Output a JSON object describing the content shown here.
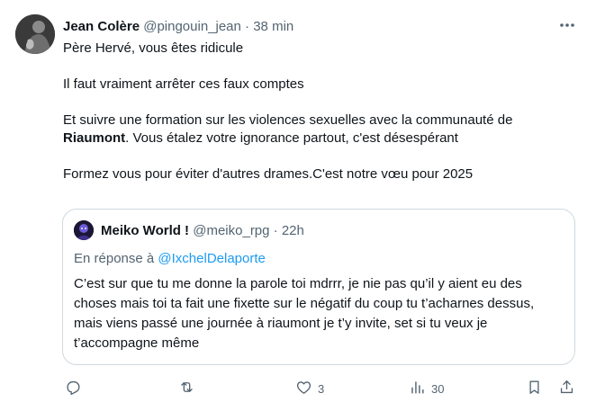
{
  "tweet": {
    "author_name": "Jean Colère",
    "author_handle": "@pingouin_jean",
    "separator": "·",
    "time": "38 min",
    "paragraphs": {
      "p1": "Père Hervé, vous êtes ridicule",
      "p2": "Il faut vraiment arrêter ces faux comptes",
      "p3a": "Et suivre une formation sur les violences sexuelles avec la communauté de",
      "p3_bold": "Riaumont",
      "p3b": ". Vous étalez votre ignorance partout, c'est désespérant",
      "p4": "Formez vous pour éviter d'autres drames.C'est notre vœu pour 2025"
    }
  },
  "quote": {
    "author_name": "Meiko World !",
    "author_handle": "@meiko_rpg",
    "separator": "·",
    "time": "22h",
    "reply_prefix": "En réponse à",
    "reply_mention": "@IxchelDelaporte",
    "text": "C’est sur que tu me donne la parole toi mdrrr, je nie pas qu’il y aient eu des choses mais toi ta fait une fixette sur le négatif du coup tu t’acharnes dessus, mais viens passé une journée à riaumont je t’y invite, set si tu veux je t’accompagne même"
  },
  "actions": {
    "reply_count": "",
    "retweet_count": "",
    "like_count": "3",
    "views_count": "30"
  },
  "icons": {
    "more": "more-dots-icon",
    "reply": "reply-icon",
    "retweet": "retweet-icon",
    "like": "heart-icon",
    "views": "views-icon",
    "bookmark": "bookmark-icon",
    "share": "share-icon"
  },
  "colors": {
    "text": "#0f1419",
    "secondary": "#536471",
    "link": "#1d9bf0",
    "border": "#cfd9de"
  }
}
